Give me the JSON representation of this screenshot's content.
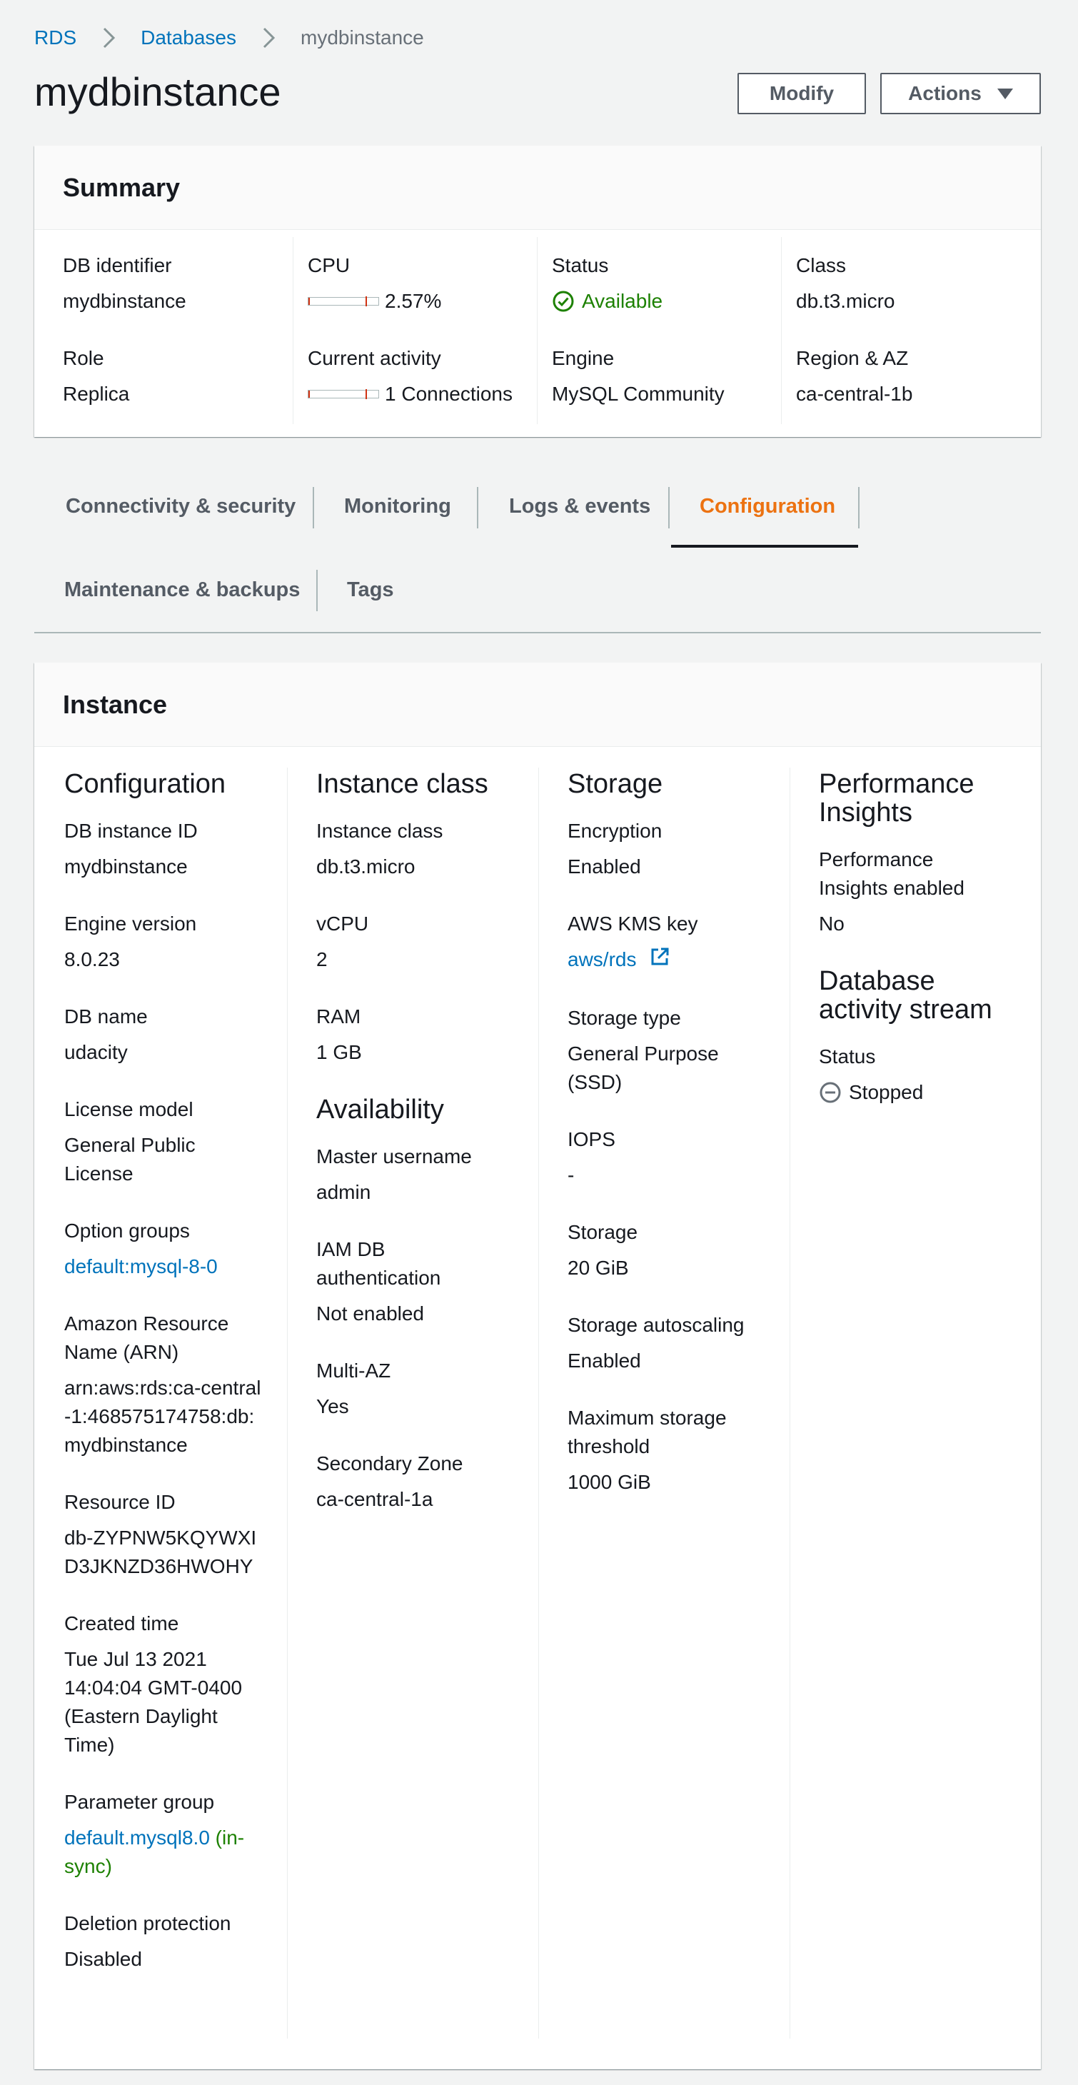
{
  "breadcrumb": {
    "items": [
      "RDS",
      "Databases",
      "mydbinstance"
    ]
  },
  "page_title": "mydbinstance",
  "actions": {
    "modify": "Modify",
    "actions": "Actions"
  },
  "summary": {
    "title": "Summary",
    "db_identifier": {
      "label": "DB identifier",
      "value": "mydbinstance"
    },
    "role": {
      "label": "Role",
      "value": "Replica"
    },
    "cpu": {
      "label": "CPU",
      "value": "2.57%",
      "fraction": 0.0257
    },
    "current_activity": {
      "label": "Current activity",
      "value": "1 Connections"
    },
    "status": {
      "label": "Status",
      "value": "Available",
      "icon": "check-circle-icon"
    },
    "engine": {
      "label": "Engine",
      "value": "MySQL Community"
    },
    "class": {
      "label": "Class",
      "value": "db.t3.micro"
    },
    "region_az": {
      "label": "Region & AZ",
      "value": "ca-central-1b"
    }
  },
  "tabs": [
    {
      "label": "Connectivity & security"
    },
    {
      "label": "Monitoring"
    },
    {
      "label": "Logs & events"
    },
    {
      "label": "Configuration",
      "active": true
    },
    {
      "label": "Maintenance & backups"
    },
    {
      "label": "Tags"
    }
  ],
  "instance": {
    "title": "Instance",
    "configuration": {
      "heading": "Configuration",
      "items": [
        {
          "label": "DB instance ID",
          "value": "mydbinstance"
        },
        {
          "label": "Engine version",
          "value": "8.0.23"
        },
        {
          "label": "DB name",
          "value": "udacity"
        },
        {
          "label": "License model",
          "value": "General Public License"
        },
        {
          "label": "Option groups",
          "value": "default:mysql-8-0"
        },
        {
          "label": "Amazon Resource Name (ARN)",
          "value": "arn:aws:rds:ca-central-1:468575174758:db:mydbinstance"
        },
        {
          "label": "Resource ID",
          "value": "db-ZYPNW5KQYWXID3JKNZD36HWOHY"
        },
        {
          "label": "Created time",
          "value": "Tue Jul 13 2021 14:04:04 GMT-0400 (Eastern Daylight Time)"
        },
        {
          "label": "Parameter group",
          "value": "default.mysql8.0",
          "status": "(in-sync)"
        },
        {
          "label": "Deletion protection",
          "value": "Disabled"
        }
      ]
    },
    "instance_class": {
      "heading": "Instance class",
      "items": [
        {
          "label": "Instance class",
          "value": "db.t3.micro"
        },
        {
          "label": "vCPU",
          "value": "2"
        },
        {
          "label": "RAM",
          "value": "1 GB"
        }
      ]
    },
    "availability": {
      "heading": "Availability",
      "items": [
        {
          "label": "Master username",
          "value": "admin"
        },
        {
          "label": "IAM DB authentication",
          "value": "Not enabled"
        },
        {
          "label": "Multi-AZ",
          "value": "Yes"
        },
        {
          "label": "Secondary Zone",
          "value": "ca-central-1a"
        }
      ]
    },
    "storage": {
      "heading": "Storage",
      "items": [
        {
          "label": "Encryption",
          "value": "Enabled"
        },
        {
          "label": "AWS KMS key",
          "value": "aws/rds",
          "icon": "external-link-icon"
        },
        {
          "label": "Storage type",
          "value": "General Purpose (SSD)"
        },
        {
          "label": "IOPS",
          "value": "-"
        },
        {
          "label": "Storage",
          "value": "20 GiB"
        },
        {
          "label": "Storage autoscaling",
          "value": "Enabled"
        },
        {
          "label": "Maximum storage threshold",
          "value": "1000 GiB"
        }
      ]
    },
    "performance_insights": {
      "heading": "Performance Insights",
      "items": [
        {
          "label": "Performance Insights enabled",
          "value": "No"
        }
      ]
    },
    "activity_stream": {
      "heading": "Database activity stream",
      "status_label": "Status",
      "status_value": "Stopped",
      "icon": "stopped-circle-icon"
    }
  },
  "colors": {
    "link": "#0073bb",
    "active_tab": "#ec7211",
    "success": "#1d8102",
    "muted": "#687078"
  }
}
